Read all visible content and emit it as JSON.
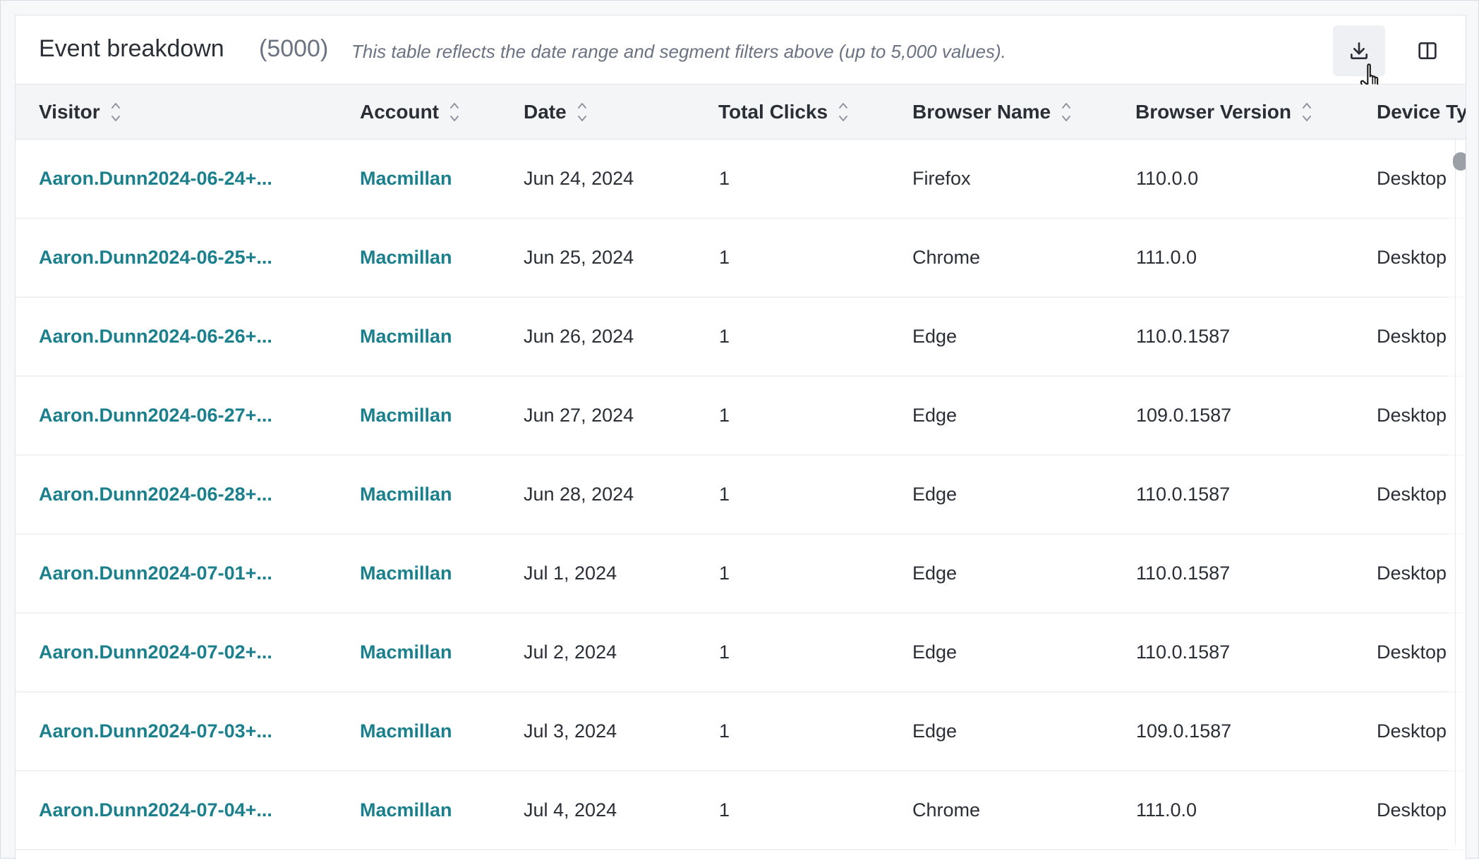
{
  "header": {
    "title": "Event breakdown",
    "count": "(5000)",
    "description": "This table reflects the date range and segment filters above (up to 5,000 values).",
    "download_icon": "download-icon",
    "columns_icon": "columns-toggle-icon"
  },
  "table": {
    "columns": [
      {
        "label": "Visitor",
        "sort_icon": "sort-icon"
      },
      {
        "label": "Account",
        "sort_icon": "sort-icon"
      },
      {
        "label": "Date",
        "sort_icon": "sort-icon"
      },
      {
        "label": "Total Clicks",
        "sort_icon": "sort-icon"
      },
      {
        "label": "Browser Name",
        "sort_icon": "sort-icon"
      },
      {
        "label": "Browser Version",
        "sort_icon": "sort-icon"
      },
      {
        "label": "Device Ty"
      }
    ],
    "rows": [
      {
        "visitor": "Aaron.Dunn2024-06-24+...",
        "account": "Macmillan",
        "date": "Jun 24, 2024",
        "clicks": "1",
        "browser": "Firefox",
        "version": "110.0.0",
        "device": "Desktop"
      },
      {
        "visitor": "Aaron.Dunn2024-06-25+...",
        "account": "Macmillan",
        "date": "Jun 25, 2024",
        "clicks": "1",
        "browser": "Chrome",
        "version": "111.0.0",
        "device": "Desktop"
      },
      {
        "visitor": "Aaron.Dunn2024-06-26+...",
        "account": "Macmillan",
        "date": "Jun 26, 2024",
        "clicks": "1",
        "browser": "Edge",
        "version": "110.0.1587",
        "device": "Desktop"
      },
      {
        "visitor": "Aaron.Dunn2024-06-27+...",
        "account": "Macmillan",
        "date": "Jun 27, 2024",
        "clicks": "1",
        "browser": "Edge",
        "version": "109.0.1587",
        "device": "Desktop"
      },
      {
        "visitor": "Aaron.Dunn2024-06-28+...",
        "account": "Macmillan",
        "date": "Jun 28, 2024",
        "clicks": "1",
        "browser": "Edge",
        "version": "110.0.1587",
        "device": "Desktop"
      },
      {
        "visitor": "Aaron.Dunn2024-07-01+...",
        "account": "Macmillan",
        "date": "Jul 1, 2024",
        "clicks": "1",
        "browser": "Edge",
        "version": "110.0.1587",
        "device": "Desktop"
      },
      {
        "visitor": "Aaron.Dunn2024-07-02+...",
        "account": "Macmillan",
        "date": "Jul 2, 2024",
        "clicks": "1",
        "browser": "Edge",
        "version": "110.0.1587",
        "device": "Desktop"
      },
      {
        "visitor": "Aaron.Dunn2024-07-03+...",
        "account": "Macmillan",
        "date": "Jul 3, 2024",
        "clicks": "1",
        "browser": "Edge",
        "version": "109.0.1587",
        "device": "Desktop"
      },
      {
        "visitor": "Aaron.Dunn2024-07-04+...",
        "account": "Macmillan",
        "date": "Jul 4, 2024",
        "clicks": "1",
        "browser": "Chrome",
        "version": "111.0.0",
        "device": "Desktop"
      }
    ]
  },
  "colors": {
    "link": "#1b7f8c",
    "header_bg": "#f4f5f7",
    "border": "#e3e6ea"
  }
}
